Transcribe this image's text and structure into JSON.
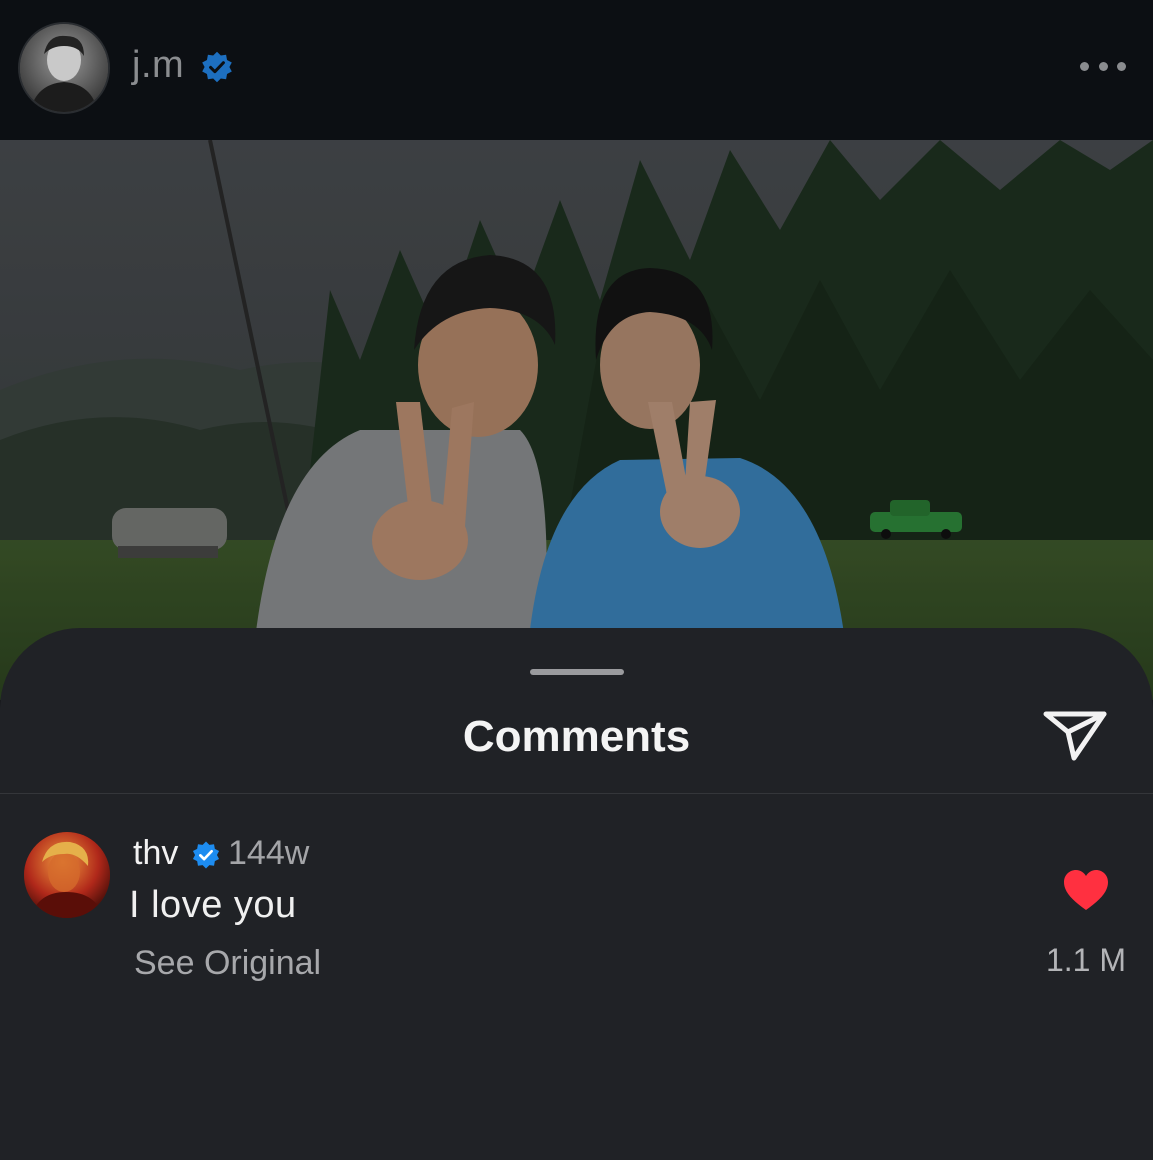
{
  "post": {
    "username": "j.m",
    "verified_icon": "verified-badge-icon",
    "more_icon": "more-options-icon"
  },
  "sheet": {
    "title": "Comments",
    "share_icon": "send-icon"
  },
  "comments": [
    {
      "username": "thv",
      "time": "144w",
      "text": "I love you",
      "see_original": "See Original",
      "likes": "1.1 M",
      "liked": true
    }
  ],
  "colors": {
    "verified": "#1d8cf0",
    "like": "#ff3040",
    "sheet_bg": "#202226",
    "header_bg": "#0c0f13"
  }
}
